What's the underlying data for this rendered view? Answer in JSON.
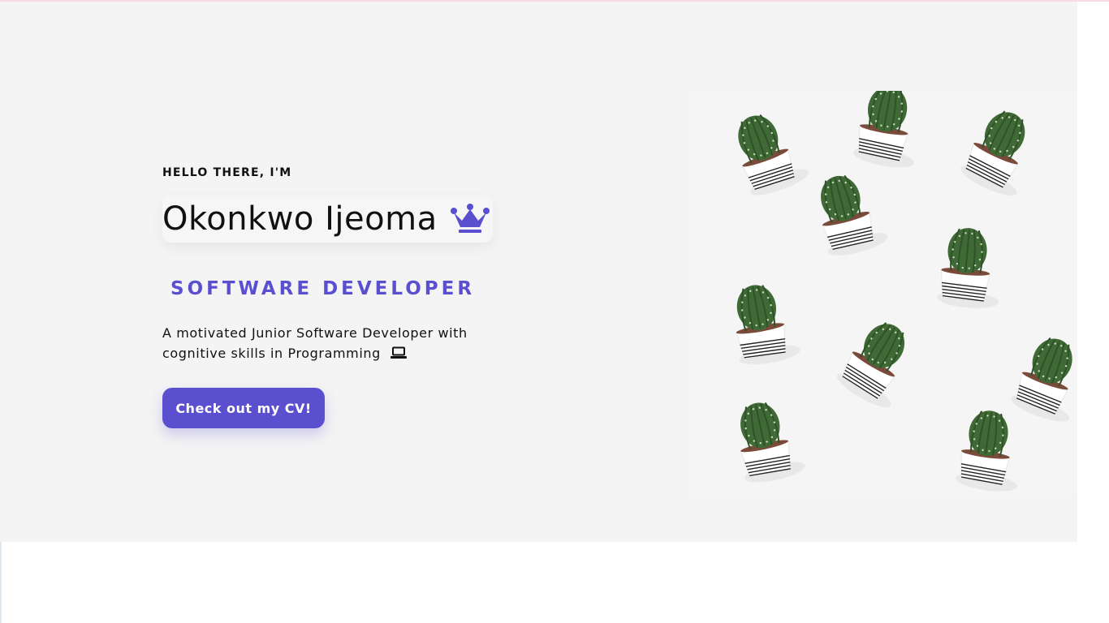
{
  "hero": {
    "greeting": "HELLO THERE, I'M",
    "name": "Okonkwo Ijeoma",
    "role": "SOFTWARE DEVELOPER",
    "description": "A motivated Junior Software Developer with cognitive skills in Programming",
    "cv_button_label": "Check out my CV!",
    "name_icon": "crown-icon",
    "description_icon": "laptop-icon"
  },
  "image": {
    "subject": "cactus-pots-photo"
  },
  "colors": {
    "accent": "#5a4fcf",
    "background": "#f4f4f4",
    "text": "#111111"
  }
}
